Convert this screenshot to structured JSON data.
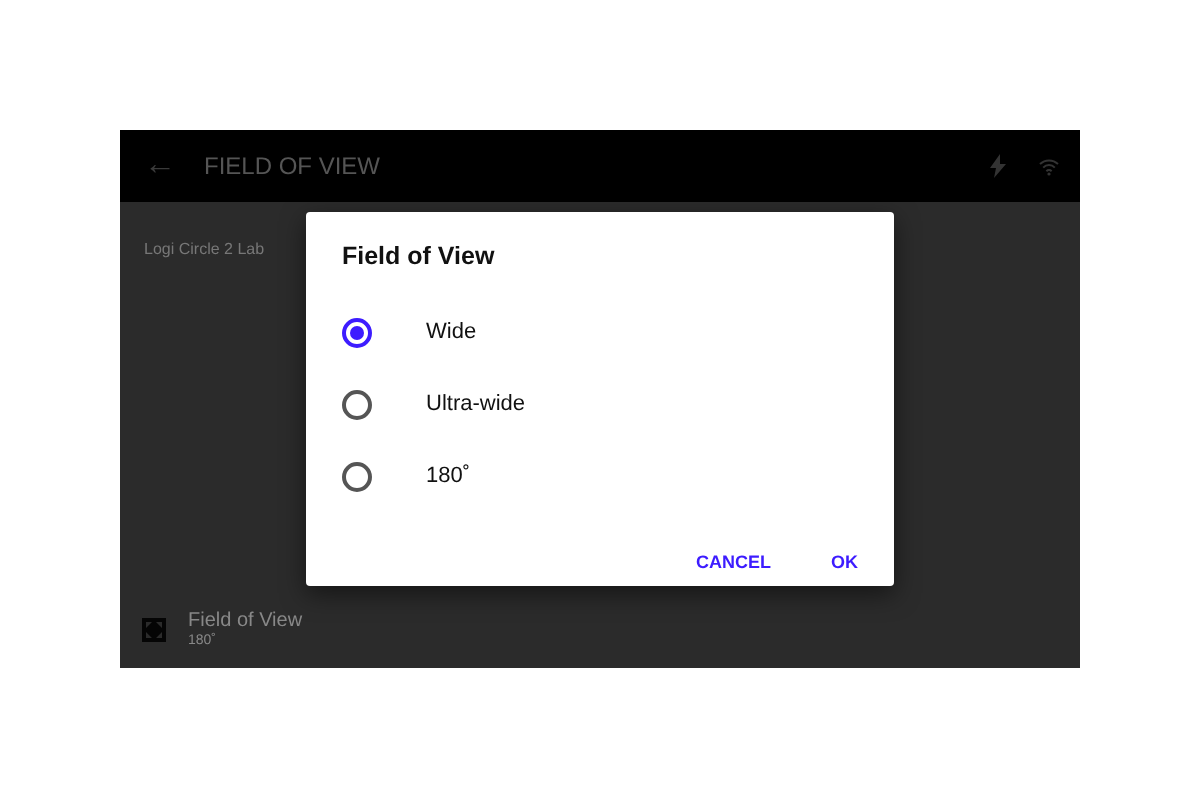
{
  "app_bar": {
    "back": "←",
    "title": "FIELD OF VIEW"
  },
  "device_name": "Logi Circle 2 Lab",
  "setting": {
    "title": "Field of View",
    "value": "180˚"
  },
  "dialog": {
    "title": "Field of View",
    "options": [
      {
        "label": "Wide",
        "selected": true
      },
      {
        "label": "Ultra-wide",
        "selected": false
      },
      {
        "label": "180˚",
        "selected": false
      }
    ],
    "buttons": [
      "CANCEL",
      "OK"
    ]
  }
}
